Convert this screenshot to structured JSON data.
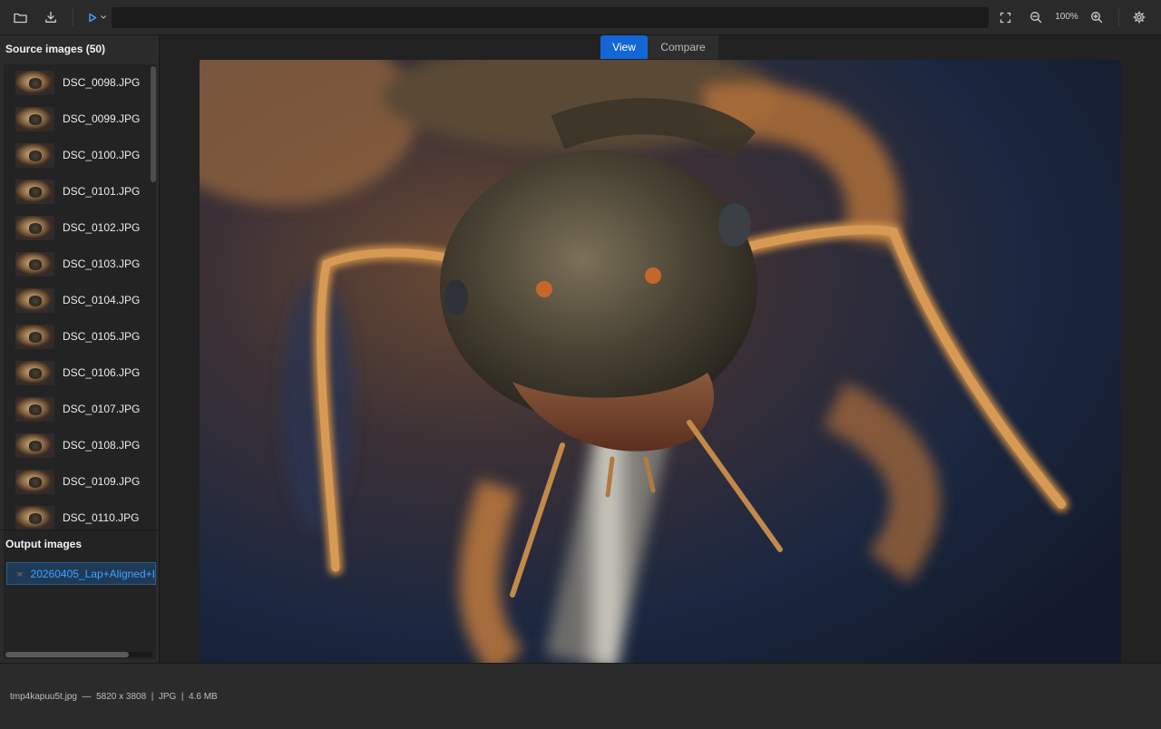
{
  "toolbar": {
    "zoom_label": "100%",
    "command_value": ""
  },
  "sidebar": {
    "source_title": "Source images (50)",
    "source_items": [
      "DSC_0098.JPG",
      "DSC_0099.JPG",
      "DSC_0100.JPG",
      "DSC_0101.JPG",
      "DSC_0102.JPG",
      "DSC_0103.JPG",
      "DSC_0104.JPG",
      "DSC_0105.JPG",
      "DSC_0106.JPG",
      "DSC_0107.JPG",
      "DSC_0108.JPG",
      "DSC_0109.JPG",
      "DSC_0110.JPG"
    ],
    "output_title": "Output images",
    "output_items": [
      "20260405_Lap+Aligned+I"
    ]
  },
  "tabs": [
    {
      "label": "View",
      "active": true
    },
    {
      "label": "Compare",
      "active": false
    }
  ],
  "status": {
    "filename": "tmp4kapuu5t.jpg",
    "dimensions": "5820 x 3808",
    "format": "JPG",
    "size": "4.6 MB"
  },
  "colors": {
    "accent": "#1266d6",
    "output_link": "#3ea2ff",
    "background": "#1e1e1e"
  },
  "icons": {
    "open": "folder-icon",
    "save": "download-icon",
    "run": "play-icon",
    "fit": "fullscreen-icon",
    "zoom_out": "zoom-out-icon",
    "zoom_in": "zoom-in-icon",
    "settings": "gear-icon"
  }
}
